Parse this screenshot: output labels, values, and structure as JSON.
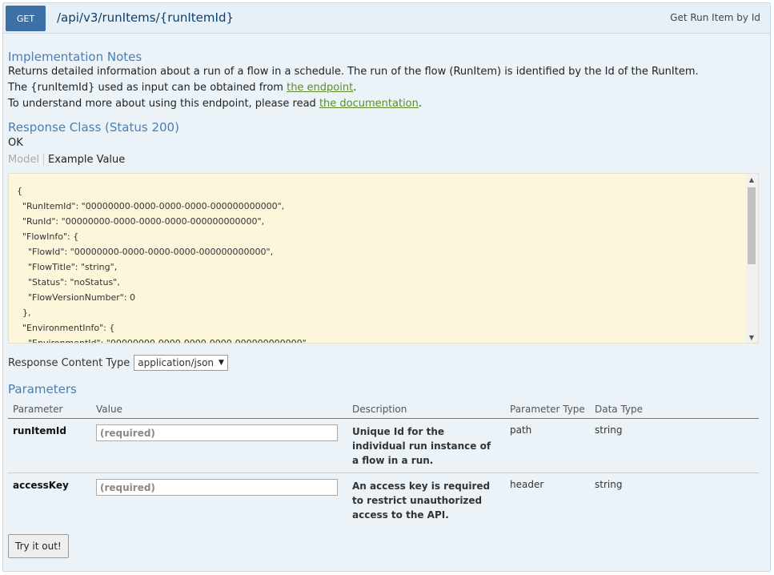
{
  "operation": {
    "method": "GET",
    "method_color": "#3d71a6",
    "path": "/api/v3/runItems/{runItemId}",
    "summary": "Get Run Item by Id"
  },
  "implementation_notes": {
    "heading": "Implementation Notes",
    "line1": "Returns detailed information about a run of a flow in a schedule. The run of the flow (RunItem) is identified by the Id of the RunItem.",
    "line2_prefix": "The {runItemId} used as input can be obtained from ",
    "line2_link": "the endpoint",
    "line2_suffix": ".",
    "line3_prefix": "To understand more about using this endpoint, please read ",
    "line3_link": "the documentation",
    "line3_suffix": "."
  },
  "response_class": {
    "heading": "Response Class (Status 200)",
    "status_text": "OK",
    "tab_model": "Model",
    "tab_example": "Example Value",
    "example_json": "{\n  \"RunItemId\": \"00000000-0000-0000-0000-000000000000\",\n  \"RunId\": \"00000000-0000-0000-0000-000000000000\",\n  \"FlowInfo\": {\n    \"FlowId\": \"00000000-0000-0000-0000-000000000000\",\n    \"FlowTitle\": \"string\",\n    \"Status\": \"noStatus\",\n    \"FlowVersionNumber\": 0\n  },\n  \"EnvironmentInfo\": {\n    \"EnvironmentId\": \"00000000-0000-0000-0000-000000000000\","
  },
  "content_type": {
    "label": "Response Content Type",
    "selected": "application/json"
  },
  "parameters": {
    "heading": "Parameters",
    "columns": [
      "Parameter",
      "Value",
      "Description",
      "Parameter Type",
      "Data Type"
    ],
    "rows": [
      {
        "name": "runItemId",
        "placeholder": "(required)",
        "description": "Unique Id for the individual run instance of a flow in a run.",
        "param_type": "path",
        "data_type": "string"
      },
      {
        "name": "accessKey",
        "placeholder": "(required)",
        "description": "An access key is required to restrict unauthorized access to the API.",
        "param_type": "header",
        "data_type": "string"
      }
    ]
  },
  "try_button": "Try it out!"
}
